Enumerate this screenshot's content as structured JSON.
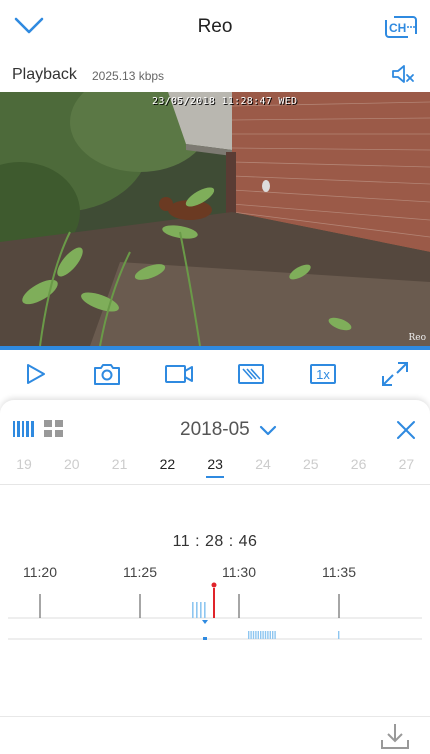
{
  "header": {
    "title": "Reo",
    "back_icon": "chevron-down-icon",
    "channel_icon": "channel-icon",
    "channel_label": "CH"
  },
  "playback": {
    "label": "Playback",
    "bitrate": "2025.13 kbps",
    "mute_icon": "speaker-muted-icon"
  },
  "video": {
    "osd_timestamp": "23/05/2018 11:28:47 WED",
    "watermark": "Reo",
    "progress_fraction": 1.0
  },
  "toolbar": {
    "items": [
      {
        "name": "play-icon"
      },
      {
        "name": "camera-icon"
      },
      {
        "name": "record-icon"
      },
      {
        "name": "hide-stream-icon"
      },
      {
        "name": "speed-button",
        "label": "1x"
      },
      {
        "name": "fullscreen-icon"
      }
    ]
  },
  "calendar": {
    "month": "2018-05",
    "days": [
      "19",
      "20",
      "21",
      "22",
      "23",
      "24",
      "25",
      "26",
      "27"
    ],
    "days_with_recordings": [
      "22",
      "23"
    ],
    "selected_day": "23"
  },
  "timeline": {
    "current_time": "11 : 28 : 46",
    "tick_labels": [
      "11:20",
      "11:25",
      "11:30",
      "11:35"
    ],
    "accent": "#2f8ae0",
    "cursor_color": "#e0242a",
    "recording_color": "#8ec6f0"
  }
}
